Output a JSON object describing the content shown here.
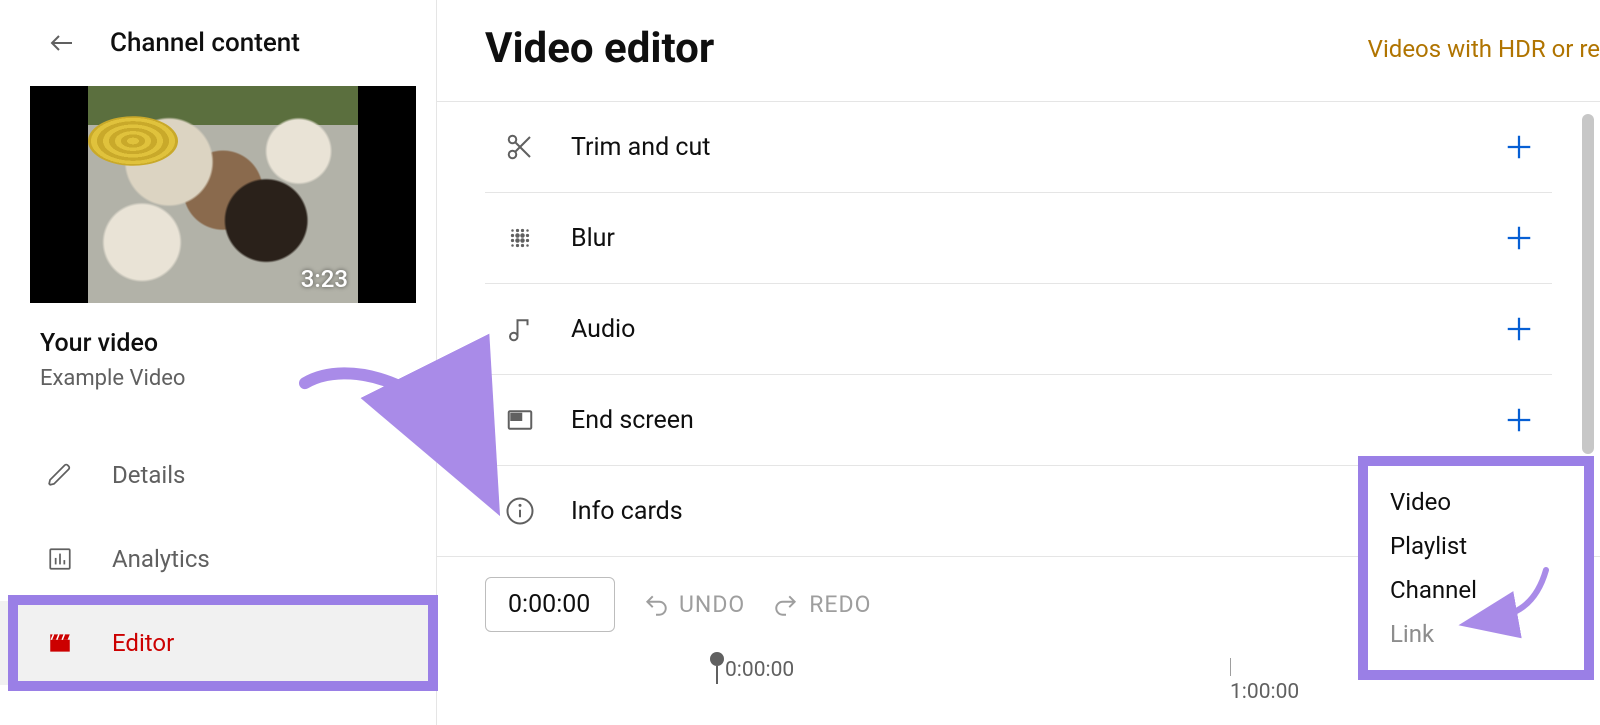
{
  "sidebar": {
    "header": "Channel content",
    "thumbnail_duration": "3:23",
    "your_video_label": "Your video",
    "video_title": "Example Video",
    "nav": {
      "details": "Details",
      "analytics": "Analytics",
      "editor": "Editor"
    }
  },
  "main": {
    "title": "Video editor",
    "hdr_link": "Videos with HDR or re",
    "tools": {
      "trim": "Trim and cut",
      "blur": "Blur",
      "audio": "Audio",
      "endscreen": "End screen",
      "infocards": "Info cards"
    },
    "timeline": {
      "current": "0:00:00",
      "undo": "UNDO",
      "redo": "REDO",
      "tick0": "0:00:00",
      "tick1": "1:00:00"
    },
    "infocards_menu": {
      "video": "Video",
      "playlist": "Playlist",
      "channel": "Channel",
      "link": "Link"
    }
  }
}
